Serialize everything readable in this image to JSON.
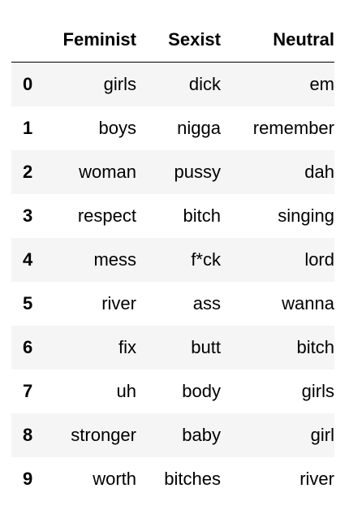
{
  "table": {
    "columns": [
      "Feminist",
      "Sexist",
      "Neutral"
    ],
    "rows": [
      {
        "index": "0",
        "cells": [
          "girls",
          "dick",
          "em"
        ]
      },
      {
        "index": "1",
        "cells": [
          "boys",
          "nigga",
          "remember"
        ]
      },
      {
        "index": "2",
        "cells": [
          "woman",
          "pussy",
          "dah"
        ]
      },
      {
        "index": "3",
        "cells": [
          "respect",
          "bitch",
          "singing"
        ]
      },
      {
        "index": "4",
        "cells": [
          "mess",
          "f*ck",
          "lord"
        ]
      },
      {
        "index": "5",
        "cells": [
          "river",
          "ass",
          "wanna"
        ]
      },
      {
        "index": "6",
        "cells": [
          "fix",
          "butt",
          "bitch"
        ]
      },
      {
        "index": "7",
        "cells": [
          "uh",
          "body",
          "girls"
        ]
      },
      {
        "index": "8",
        "cells": [
          "stronger",
          "baby",
          "girl"
        ]
      },
      {
        "index": "9",
        "cells": [
          "worth",
          "bitches",
          "river"
        ]
      }
    ],
    "stripe_color": "#f5f5f5"
  }
}
